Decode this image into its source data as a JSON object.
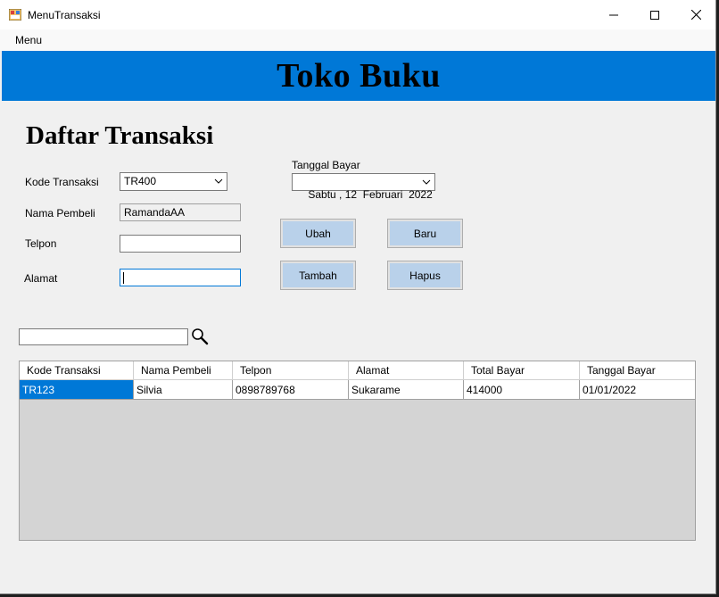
{
  "window": {
    "title": "MenuTransaksi",
    "icon": "app-icon"
  },
  "menubar": {
    "items": [
      "Menu"
    ]
  },
  "banner": {
    "title": "Toko Buku",
    "color": "#0078d7"
  },
  "form": {
    "heading": "Daftar Transaksi",
    "kode_transaksi": {
      "label": "Kode Transaksi",
      "value": "TR400"
    },
    "nama_pembeli": {
      "label": "Nama Pembeli",
      "value": "RamandaAA"
    },
    "telpon": {
      "label": "Telpon",
      "value": ""
    },
    "alamat": {
      "label": "Alamat",
      "value": ""
    },
    "tanggal_bayar": {
      "label": "Tanggal Bayar",
      "value": "Sabtu , 12  Februari  2022"
    }
  },
  "buttons": {
    "ubah": "Ubah",
    "baru": "Baru",
    "tambah": "Tambah",
    "hapus": "Hapus"
  },
  "search": {
    "value": "",
    "icon": "magnifier-icon"
  },
  "table": {
    "columns": [
      "Kode Transaksi",
      "Nama Pembeli",
      "Telpon",
      "Alamat",
      "Total Bayar",
      "Tanggal Bayar"
    ],
    "rows": [
      [
        "TR123",
        "Silvia",
        "0898789768",
        "Sukarame",
        "414000",
        "01/01/2022"
      ]
    ],
    "selection_color": "#0078d7"
  }
}
